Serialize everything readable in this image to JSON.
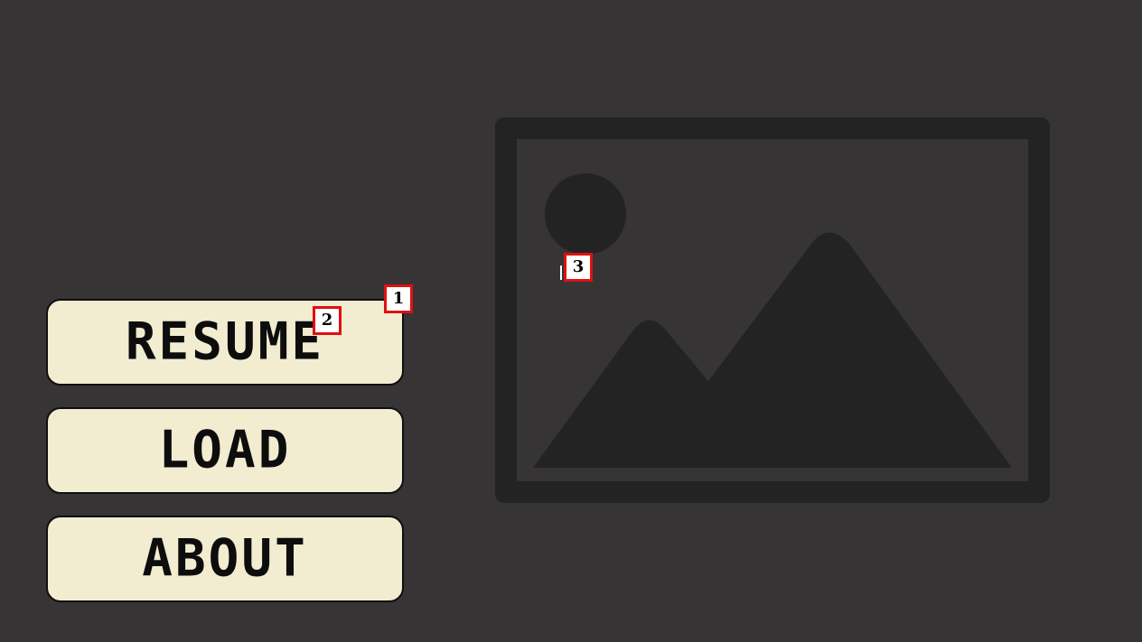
{
  "menu": {
    "buttons": [
      {
        "label": "RESUME"
      },
      {
        "label": "LOAD"
      },
      {
        "label": "ABOUT"
      }
    ]
  },
  "preview": {
    "icon": "image-placeholder-icon"
  },
  "markers": [
    "1",
    "2",
    "3"
  ],
  "colors": {
    "background": "#363435",
    "button_fill": "#f2ecd0",
    "button_border": "#0f0f0f",
    "button_text": "#0d0d0d",
    "placeholder_dark": "#232323",
    "marker_border": "#e01010"
  }
}
